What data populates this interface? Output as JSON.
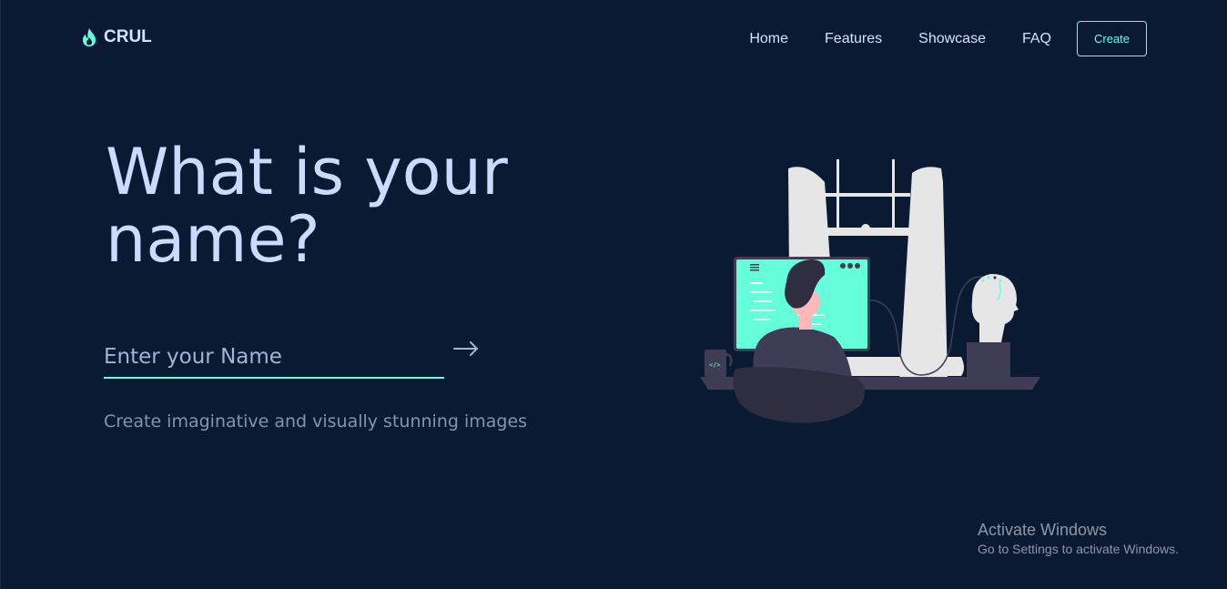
{
  "brand": {
    "name": "CRUL",
    "icon": "flame-icon",
    "accent": "#64ffda"
  },
  "nav": {
    "items": [
      "Home",
      "Features",
      "Showcase",
      "FAQ"
    ],
    "create_label": "Create"
  },
  "hero": {
    "headline_line1": "What is your",
    "headline_line2": "name?",
    "input_placeholder": "Enter your Name",
    "input_value": "",
    "subtitle": "Create imaginative and visually stunning images",
    "submit_icon": "arrow-right-icon"
  },
  "watermark": {
    "title": "Activate Windows",
    "subtitle": "Go to Settings to activate Windows."
  },
  "colors": {
    "background": "#0b1a33",
    "heading": "#cdd9ff",
    "muted": "#8892b0"
  }
}
